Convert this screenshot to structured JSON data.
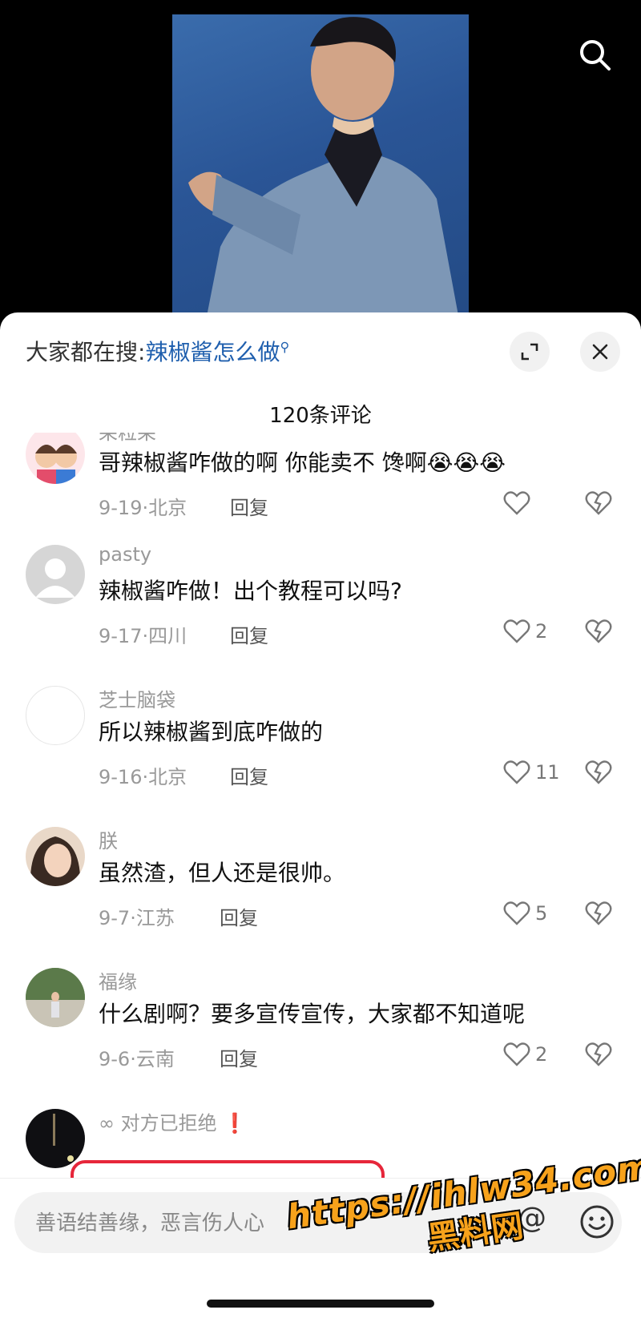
{
  "video": {
    "search_icon": "search-icon"
  },
  "header": {
    "hot_prefix": "大家都在搜:",
    "hot_keyword": "辣椒酱怎么做",
    "expand_icon": "expand-icon",
    "close_icon": "close-icon"
  },
  "comment_count": "120条评论",
  "comments": [
    {
      "user": "呆粒呆",
      "text": "哥辣椒酱咋做的啊 你能卖不 馋啊😭😭😭",
      "date": "9-19·北京",
      "reply": "回复",
      "likes": ""
    },
    {
      "user": "pasty",
      "text": "辣椒酱咋做！出个教程可以吗?",
      "date": "9-17·四川",
      "reply": "回复",
      "likes": "2"
    },
    {
      "user": "芝士脑袋",
      "text": "所以辣椒酱到底咋做的",
      "date": "9-16·北京",
      "reply": "回复",
      "likes": "11"
    },
    {
      "user": "朕",
      "text": "虽然渣，但人还是很帅。",
      "date": "9-7·江苏",
      "reply": "回复",
      "likes": "5"
    },
    {
      "user": "福缘",
      "text": "什么剧啊？要多宣传宣传，大家都不知道呢",
      "date": "9-6·云南",
      "reply": "回复",
      "likes": "2"
    },
    {
      "user": "对方已拒绝",
      "badge": "❗"
    }
  ],
  "input": {
    "placeholder": "善语结善缘，恶言伤人心",
    "at_symbol": "@"
  },
  "watermark": {
    "url": "https://ihlw34.com",
    "brand": "黑料网"
  },
  "colors": {
    "highlight": "#e6263a",
    "keyword": "#1f5fae",
    "watermark": "#f7a21b"
  }
}
